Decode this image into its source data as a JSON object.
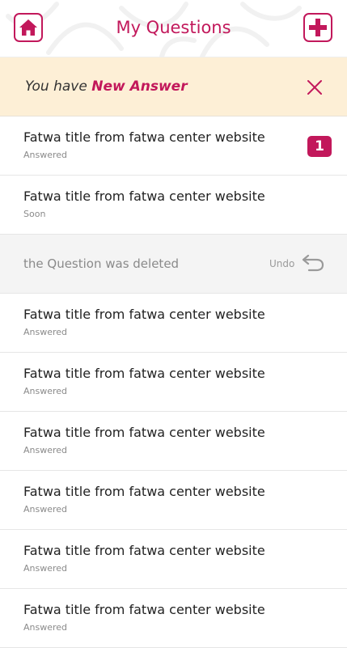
{
  "header": {
    "title": "My Questions",
    "home_icon": "home-icon",
    "add_icon": "plus-icon",
    "accent": "#c2185b"
  },
  "banner": {
    "prefix": "You have ",
    "emphasis": "New Answer",
    "close_icon": "close-icon",
    "background": "#fdefd6"
  },
  "questions": [
    {
      "title": "Fatwa title from fatwa center website",
      "status": "Answered",
      "badge": "1"
    },
    {
      "title": "Fatwa title from fatwa center website",
      "status": "Soon"
    }
  ],
  "deleted": {
    "message": "the Question was deleted",
    "undo_label": "Undo",
    "undo_icon": "undo-icon"
  },
  "more_questions": [
    {
      "title": "Fatwa title from fatwa center website",
      "status": "Answered"
    },
    {
      "title": "Fatwa title from fatwa center website",
      "status": "Answered"
    },
    {
      "title": "Fatwa title from fatwa center website",
      "status": "Answered"
    },
    {
      "title": "Fatwa title from fatwa center website",
      "status": "Answered"
    },
    {
      "title": "Fatwa title from fatwa center website",
      "status": "Answered"
    },
    {
      "title": "Fatwa title from fatwa center website",
      "status": "Answered"
    }
  ]
}
